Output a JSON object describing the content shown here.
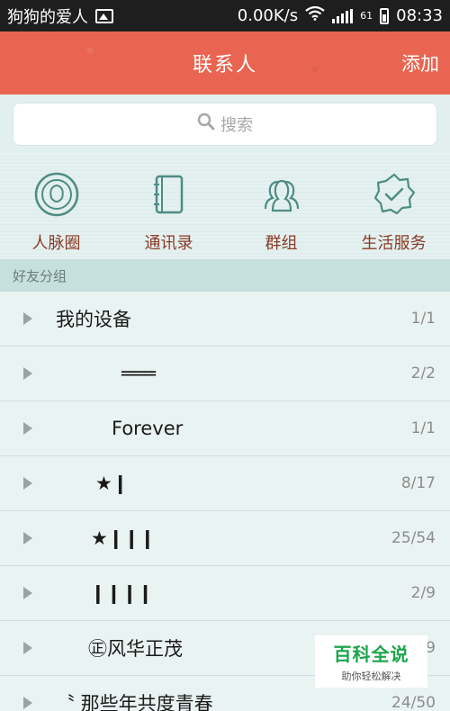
{
  "status_bar": {
    "app_name": "狗狗的爱人",
    "network_speed": "0.00K/s",
    "battery_level": "61",
    "time": "08:33"
  },
  "header": {
    "title": "联系人",
    "add_label": "添加"
  },
  "search": {
    "placeholder": "搜索"
  },
  "shortcuts": [
    {
      "label": "人脉圈",
      "icon": "person-circle-icon"
    },
    {
      "label": "通讯录",
      "icon": "address-book-icon"
    },
    {
      "label": "群组",
      "icon": "group-icon"
    },
    {
      "label": "生活服务",
      "icon": "badge-check-icon"
    }
  ],
  "section": {
    "title": "好友分组"
  },
  "groups": [
    {
      "name": "我的设备",
      "count": "1/1"
    },
    {
      "name": "═══",
      "count": "2/2"
    },
    {
      "name": "Forever",
      "count": "1/1"
    },
    {
      "name": "★❙",
      "count": "8/17"
    },
    {
      "name": "★❙❙❙",
      "count": "25/54"
    },
    {
      "name": "❙❙❙❙",
      "count": "2/9"
    },
    {
      "name": "㊣风华正茂",
      "count": "9"
    },
    {
      "name": "〝 那些年共度青春",
      "count": "24/50"
    }
  ],
  "watermark": {
    "title": "百科全说",
    "subtitle": "助你轻松解决"
  },
  "colors": {
    "header": "#e96551",
    "accent_icon": "#4e8c85",
    "shortcut_label": "#8a3a26"
  }
}
